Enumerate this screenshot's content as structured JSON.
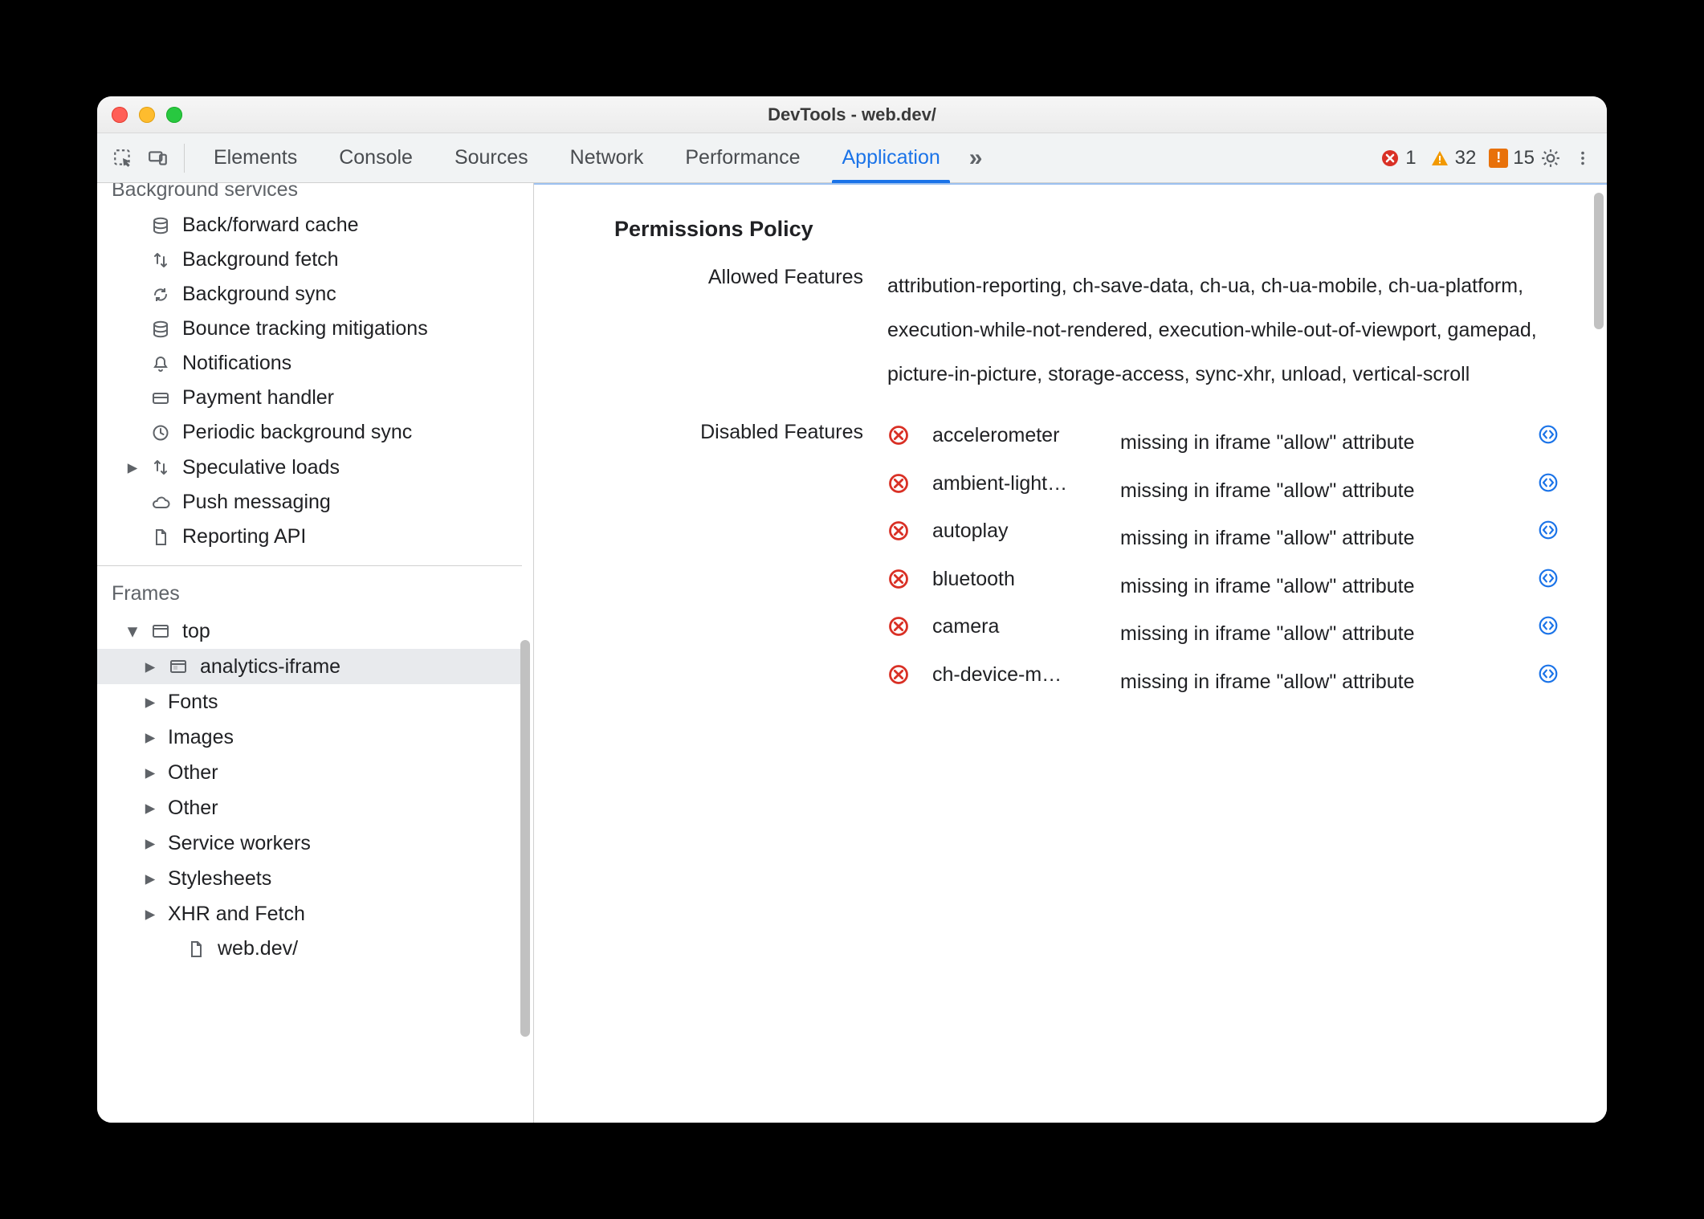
{
  "window": {
    "title": "DevTools - web.dev/"
  },
  "tabs": {
    "items": [
      "Elements",
      "Console",
      "Sources",
      "Network",
      "Performance",
      "Application"
    ],
    "active": "Application",
    "overflow_glyph": "»"
  },
  "counts": {
    "errors": 1,
    "warnings": 32,
    "issues": 15
  },
  "sidebar": {
    "bg_group_cut": "Background services",
    "bg_items": [
      {
        "icon": "db",
        "label": "Back/forward cache"
      },
      {
        "icon": "updown",
        "label": "Background fetch"
      },
      {
        "icon": "sync",
        "label": "Background sync"
      },
      {
        "icon": "db",
        "label": "Bounce tracking mitigations"
      },
      {
        "icon": "bell",
        "label": "Notifications"
      },
      {
        "icon": "card",
        "label": "Payment handler"
      },
      {
        "icon": "clock",
        "label": "Periodic background sync"
      },
      {
        "icon": "updown",
        "label": "Speculative loads",
        "expandable": true
      },
      {
        "icon": "cloud",
        "label": "Push messaging"
      },
      {
        "icon": "doc",
        "label": "Reporting API"
      }
    ],
    "frames_title": "Frames",
    "top_label": "top",
    "selected_child": "analytics-iframe",
    "top_children": [
      "Fonts",
      "Images",
      "Other",
      "Other",
      "Service workers",
      "Stylesheets",
      "XHR and Fetch"
    ],
    "leaf_doc": "web.dev/"
  },
  "main": {
    "section_title": "Permissions Policy",
    "allowed_label": "Allowed Features",
    "allowed_text": "attribution-reporting, ch-save-data, ch-ua, ch-ua-mobile, ch-ua-platform, execution-while-not-rendered, execution-while-out-of-viewport, gamepad, picture-in-picture, storage-access, sync-xhr, unload, vertical-scroll",
    "disabled_label": "Disabled Features",
    "disabled_reason": "missing in iframe \"allow\" attribute",
    "disabled": [
      "accelerometer",
      "ambient-light…",
      "autoplay",
      "bluetooth",
      "camera",
      "ch-device-m…"
    ]
  }
}
